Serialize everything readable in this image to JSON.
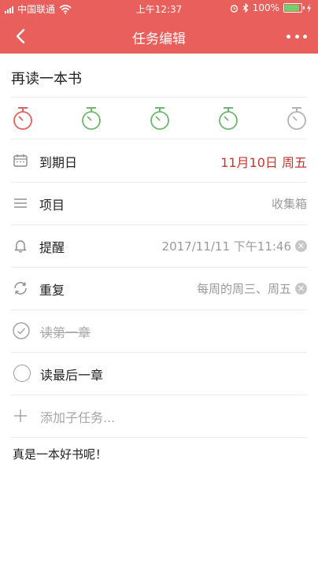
{
  "status_bar": {
    "carrier": "中国联通",
    "time": "上午12:37",
    "battery_text": "100%",
    "battery_level": 1.0
  },
  "header": {
    "title": "任务编辑",
    "back_icon": "chevron-left-icon",
    "more_icon": "more-dots-icon",
    "background": "#e85f5b"
  },
  "task": {
    "title": "再读一本书"
  },
  "timers": [
    {
      "icon": "stopwatch-icon",
      "color": "#e0605b"
    },
    {
      "icon": "stopwatch-icon",
      "color": "#6cb86a"
    },
    {
      "icon": "stopwatch-icon",
      "color": "#6cb86a"
    },
    {
      "icon": "stopwatch-icon",
      "color": "#6cb86a"
    },
    {
      "icon": "stopwatch-icon",
      "color": "#b3b3b3"
    }
  ],
  "fields": {
    "due_date": {
      "label": "到期日",
      "value": "11月10日 周五",
      "icon": "calendar-icon"
    },
    "project": {
      "label": "项目",
      "value": "收集箱",
      "icon": "list-icon"
    },
    "reminder": {
      "label": "提醒",
      "value": "2017/11/11 下午11:46",
      "icon": "bell-icon",
      "clear_icon": "clear-icon"
    },
    "repeat": {
      "label": "重复",
      "value": "每周的周三、周五",
      "icon": "repeat-icon",
      "clear_icon": "clear-icon"
    }
  },
  "subtasks": [
    {
      "label": "读第一章",
      "done": true
    },
    {
      "label": "读最后一章",
      "done": false
    }
  ],
  "add_subtask": {
    "placeholder": "添加子任务...",
    "icon": "plus-icon"
  },
  "note": "真是一本好书呢！",
  "colors": {
    "accent": "#e85f5b",
    "due_date_text": "#c8362f",
    "timer_green": "#6cb86a"
  }
}
